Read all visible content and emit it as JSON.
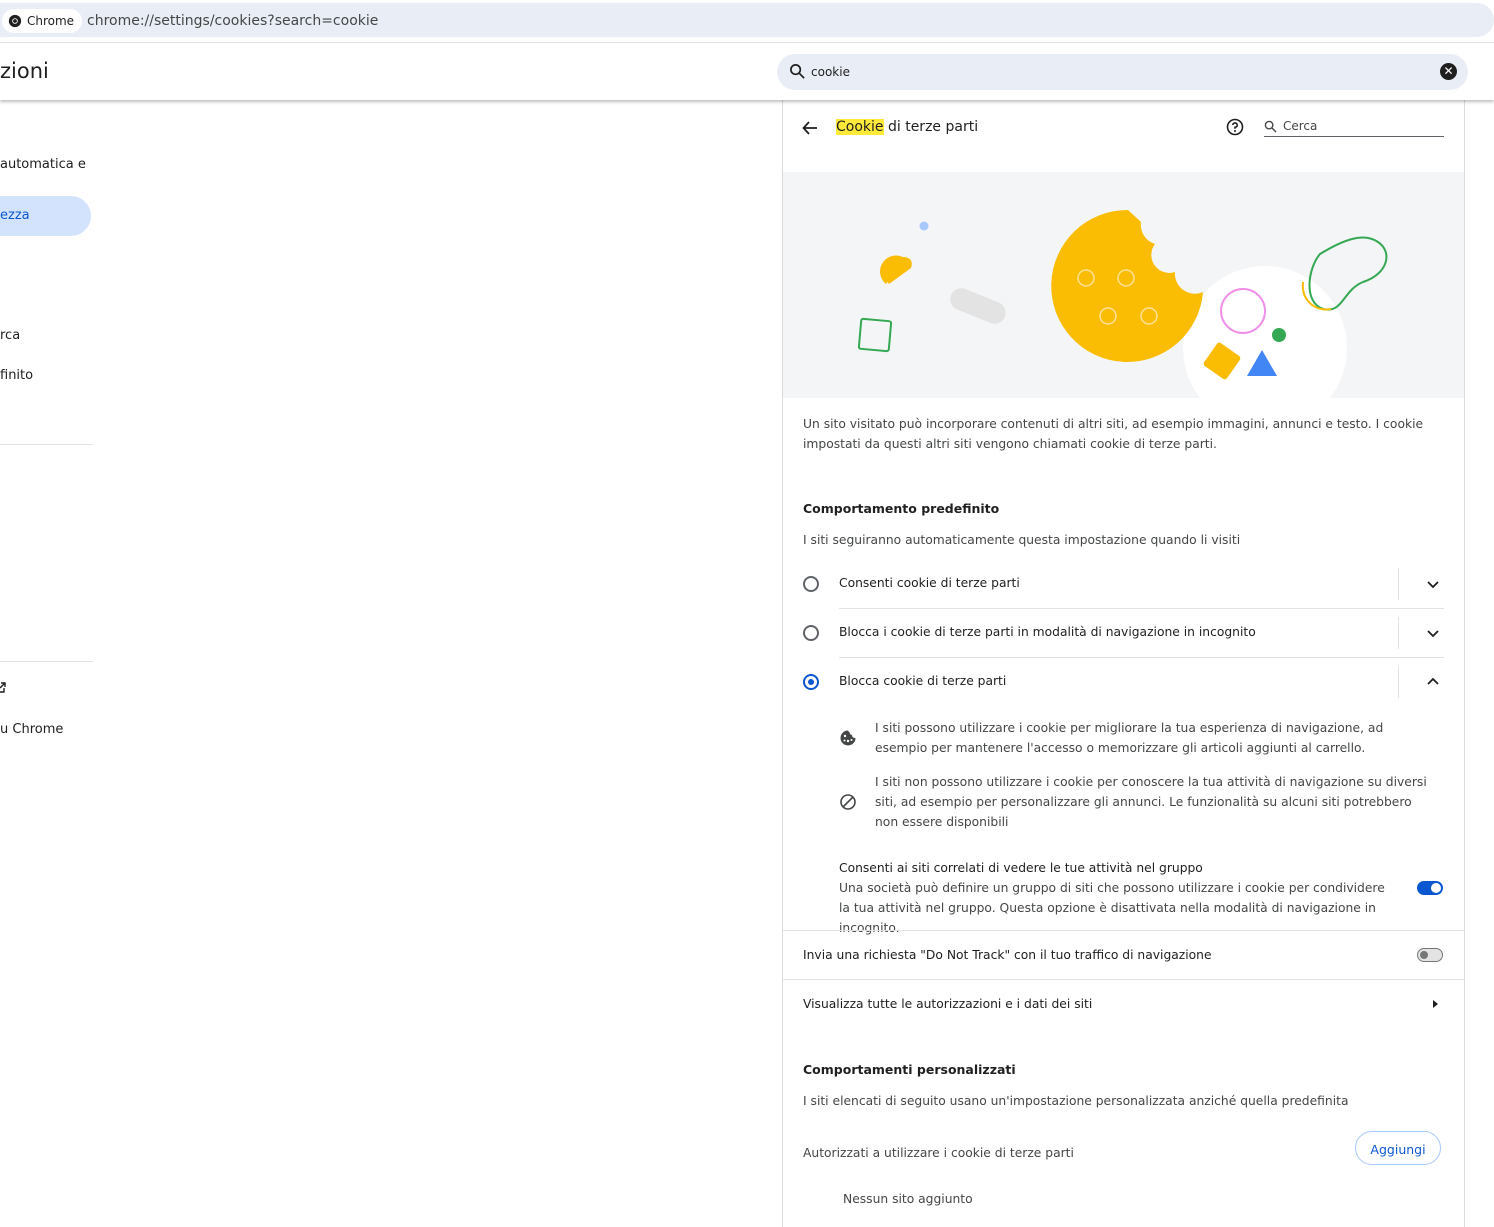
{
  "browser": {
    "chip_label": "Chrome",
    "url": "chrome://settings/cookies?search=cookie"
  },
  "header": {
    "title_fragment": "zioni",
    "search_value": "cookie"
  },
  "nav": {
    "items": [
      "automatica e",
      "ezza",
      "rca",
      "finito",
      "u Chrome"
    ]
  },
  "page": {
    "title_highlight": "Cookie",
    "title_rest": " di terze parti",
    "search_placeholder": "Cerca",
    "intro": "Un sito visitato può incorporare contenuti di altri siti, ad esempio immagini, annunci e testo. I cookie impostati da questi altri siti vengono chiamati cookie di terze parti.",
    "default_title": "Comportamento predefinito",
    "default_sub": "I siti seguiranno automaticamente questa impostazione quando li visiti",
    "options": [
      {
        "label": "Consenti cookie di terze parti",
        "selected": false
      },
      {
        "label": "Blocca i cookie di terze parti in modalità di navigazione in incognito",
        "selected": false
      },
      {
        "label": "Blocca cookie di terze parti",
        "selected": true
      }
    ],
    "details": [
      {
        "icon": "cookie-icon",
        "text": "I siti possono utilizzare i cookie per migliorare la tua esperienza di navigazione, ad esempio per mantenere l'accesso o memorizzare gli articoli aggiunti al carrello."
      },
      {
        "icon": "block-icon",
        "text": "I siti non possono utilizzare i cookie per conoscere la tua attività di navigazione su diversi siti, ad esempio per personalizzare gli annunci. Le funzionalità su alcuni siti potrebbero non essere disponibili"
      }
    ],
    "related_sites": {
      "title": "Consenti ai siti correlati di vedere le tue attività nel gruppo",
      "desc": "Una società può definire un gruppo di siti che possono utilizzare i cookie per condividere la tua attività nel gruppo. Questa opzione è disattivata nella modalità di navigazione in incognito.",
      "enabled": true
    },
    "dnt": {
      "label": "Invia una richiesta \"Do Not Track\" con il tuo traffico di navigazione",
      "enabled": false
    },
    "all_sites_link": "Visualizza tutte le autorizzazioni e i dati dei siti",
    "custom_title": "Comportamenti personalizzati",
    "custom_sub": "I siti elencati di seguito usano un'impostazione personalizzata anziché quella predefinita",
    "allowed_label": "Autorizzati a utilizzare i cookie di terze parti",
    "add_button": "Aggiungi",
    "empty_text": "Nessun sito aggiunto"
  },
  "colors": {
    "accent": "#0b57d0",
    "highlight": "#ffea3a",
    "cookie_yellow": "#fbbc04"
  }
}
